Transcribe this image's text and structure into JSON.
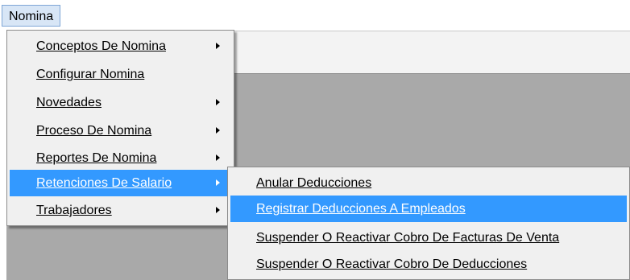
{
  "menubar": {
    "nomina_label": "Nomina"
  },
  "main_menu": {
    "items": [
      {
        "label": "Conceptos De Nomina",
        "has_submenu": true
      },
      {
        "label": "Configurar Nomina",
        "has_submenu": false
      },
      {
        "label": "Novedades",
        "has_submenu": true
      },
      {
        "label": "Proceso De Nomina",
        "has_submenu": true
      },
      {
        "label": "Reportes De Nomina",
        "has_submenu": true
      },
      {
        "label": "Retenciones De Salario",
        "has_submenu": true,
        "highlighted": true
      },
      {
        "label": "Trabajadores",
        "has_submenu": true
      }
    ]
  },
  "sub_menu": {
    "items": [
      {
        "label": "Anular Deducciones"
      },
      {
        "label": "Registrar Deducciones A Empleados",
        "highlighted": true
      },
      {
        "label": "Suspender O Reactivar Cobro De Facturas De Venta"
      },
      {
        "label": "Suspender O Reactivar Cobro De Deducciones"
      }
    ]
  },
  "colors": {
    "highlight": "#3399ff",
    "menu_bg": "#f0f0f0",
    "workspace_bg": "#a9a9a9"
  }
}
